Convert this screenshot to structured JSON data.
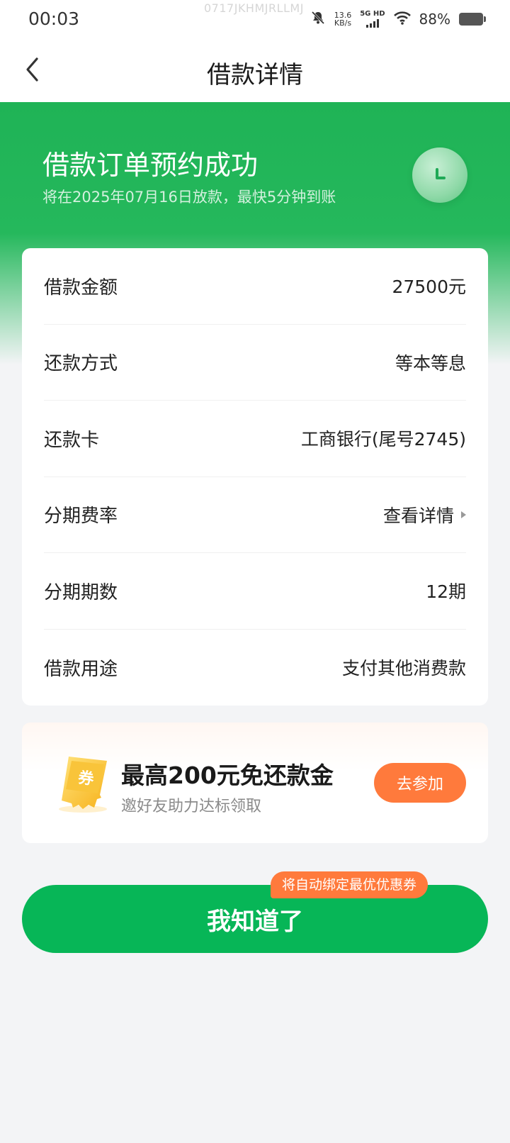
{
  "status_bar": {
    "time": "00:03",
    "watermark": "0717JKHMJRLLMJ",
    "net_speed_value": "13.6",
    "net_speed_unit": "KB/s",
    "signal_label": "5G HD",
    "battery": "88%"
  },
  "nav": {
    "title": "借款详情"
  },
  "hero": {
    "title": "借款订单预约成功",
    "subtitle": "将在2025年07月16日放款，最快5分钟到账"
  },
  "details": {
    "rows": [
      {
        "label": "借款金额",
        "value": "27500元"
      },
      {
        "label": "还款方式",
        "value": "等本等息"
      },
      {
        "label": "还款卡",
        "value": "工商银行(尾号2745)"
      },
      {
        "label": "分期费率",
        "value": "查看详情"
      },
      {
        "label": "分期期数",
        "value": "12期"
      },
      {
        "label": "借款用途",
        "value": "支付其他消费款"
      }
    ]
  },
  "promo": {
    "coupon_char": "券",
    "title": "最高200元免还款金",
    "subtitle": "邀好友助力达标领取",
    "button": "去参加"
  },
  "confirm": {
    "label": "我知道了",
    "tag": "将自动绑定最优优惠券"
  },
  "colors": {
    "primary_green": "#07b657",
    "accent_orange": "#ff7a3c"
  }
}
